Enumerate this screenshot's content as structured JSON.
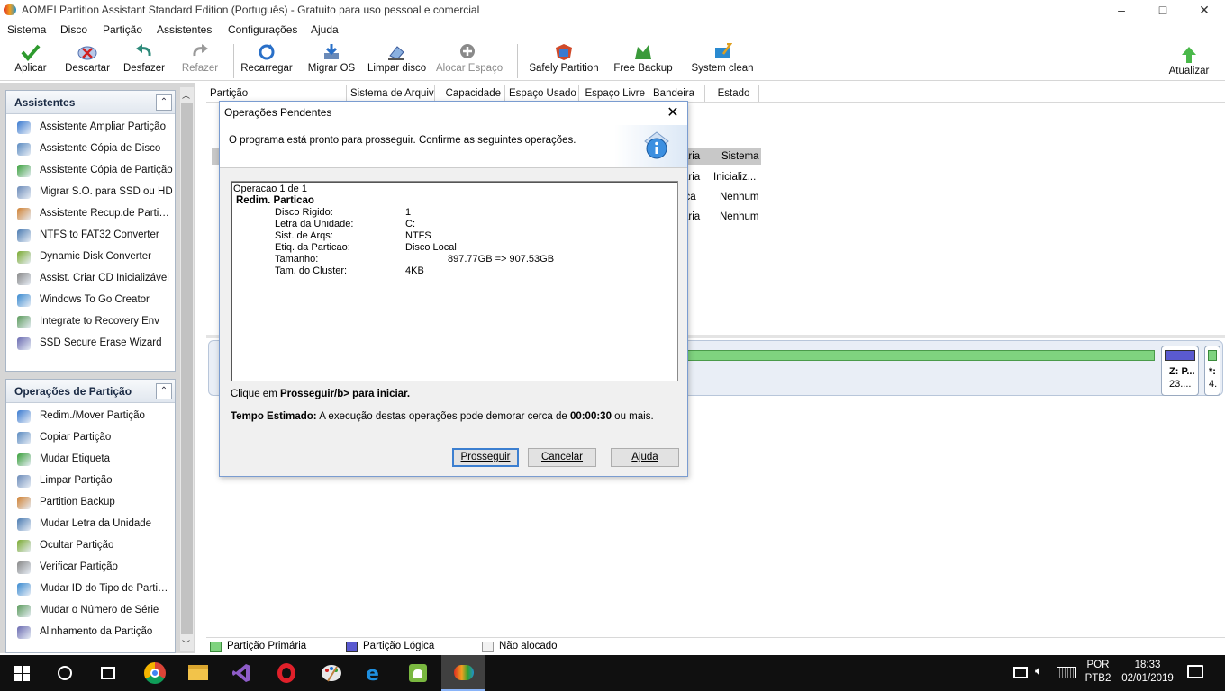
{
  "window": {
    "title": "AOMEI Partition Assistant Standard Edition (Português) - Gratuito para uso pessoal e comercial",
    "controls": [
      "–",
      "□",
      "✕"
    ]
  },
  "menu": [
    "Sistema",
    "Disco",
    "Partição",
    "Assistentes",
    "Configurações",
    "Ajuda"
  ],
  "toolbar": {
    "aplicar": "Aplicar",
    "descartar": "Descartar",
    "desfazer": "Desfazer",
    "refazer": "Refazer",
    "recarregar": "Recarregar",
    "migrar": "Migrar OS",
    "limpar": "Limpar disco",
    "alocar": "Alocar Espaço",
    "safely": "Safely Partition",
    "backup": "Free Backup",
    "clean": "System clean",
    "atualizar": "Atualizar"
  },
  "assistentes": {
    "title": "Assistentes",
    "items": [
      "Assistente Ampliar Partição",
      "Assistente Cópia de Disco",
      "Assistente Cópia de Partição",
      "Migrar S.O. para SSD ou HD",
      "Assistente Recup.de Partição",
      "NTFS to FAT32 Converter",
      "Dynamic Disk Converter",
      "Assist. Criar CD Inicializável",
      "Windows To Go Creator",
      "Integrate to Recovery Env",
      "SSD Secure Erase Wizard"
    ]
  },
  "operacoes": {
    "title": "Operações de Partição",
    "items": [
      "Redim./Mover Partição",
      "Copiar Partição",
      "Mudar Etiqueta",
      "Limpar Partição",
      "Partition Backup",
      "Mudar Letra da Unidade",
      "Ocultar Partição",
      "Verificar Partição",
      "Mudar ID do Tipo de Partição",
      "Mudar o Número de Série",
      "Alinhamento da Partição"
    ]
  },
  "table": {
    "columns": [
      "Partição",
      "Sistema de Arquivos",
      "Capacidade",
      "Espaço Usado",
      "Espaço Livre",
      "Bandeira",
      "Estado"
    ],
    "behind_header": [
      "ária",
      "Sistema"
    ],
    "behind_rows": [
      [
        "ária",
        "Inicializ..."
      ],
      [
        "ica",
        "Nenhum"
      ],
      [
        "ária",
        "Nenhum"
      ]
    ]
  },
  "disk_map": {
    "z_label": "Z: P...",
    "z_size": "23....",
    "star_label": "*:",
    "star_size": "4."
  },
  "legend": {
    "primaria": "Partição Primária",
    "logica": "Partição Lógica",
    "nao_alocado": "Não alocado"
  },
  "dialog": {
    "title": "Operações Pendentes",
    "message": "O programa está pronto para prosseguir. Confirme as seguintes operações.",
    "op_counter": "Operacao 1 de 1",
    "op_title": "Redim. Particao",
    "details": [
      {
        "k": "Disco Rigido:",
        "v": "1"
      },
      {
        "k": "Letra da Unidade:",
        "v": "C:"
      },
      {
        "k": "Sist. de Arqs:",
        "v": "NTFS"
      },
      {
        "k": "Etiq. da Particao:",
        "v": "Disco Local"
      },
      {
        "k": "Tamanho:",
        "v": "897.77GB => 907.53GB"
      },
      {
        "k": "Tam. do Cluster:",
        "v": "4KB"
      }
    ],
    "click_prefix": "Clique em ",
    "click_bold": "Prosseguir/b> para iniciar.",
    "time_label": "Tempo Estimado:",
    "time_text": " A execução destas operações pode demorar cerca de ",
    "time_value": "00:00:30",
    "time_suffix": " ou mais.",
    "btn_prosseguir": "Prosseguir",
    "btn_cancelar": "Cancelar",
    "btn_ajuda": "Ajuda"
  },
  "taskbar": {
    "lang1": "POR",
    "lang2": "PTB2",
    "time": "18:33",
    "date": "02/01/2019"
  },
  "colors": {
    "primary_green": "#7fd37f",
    "logical_blue": "#5a5ad0",
    "accent_blue": "#3c7fd0"
  }
}
